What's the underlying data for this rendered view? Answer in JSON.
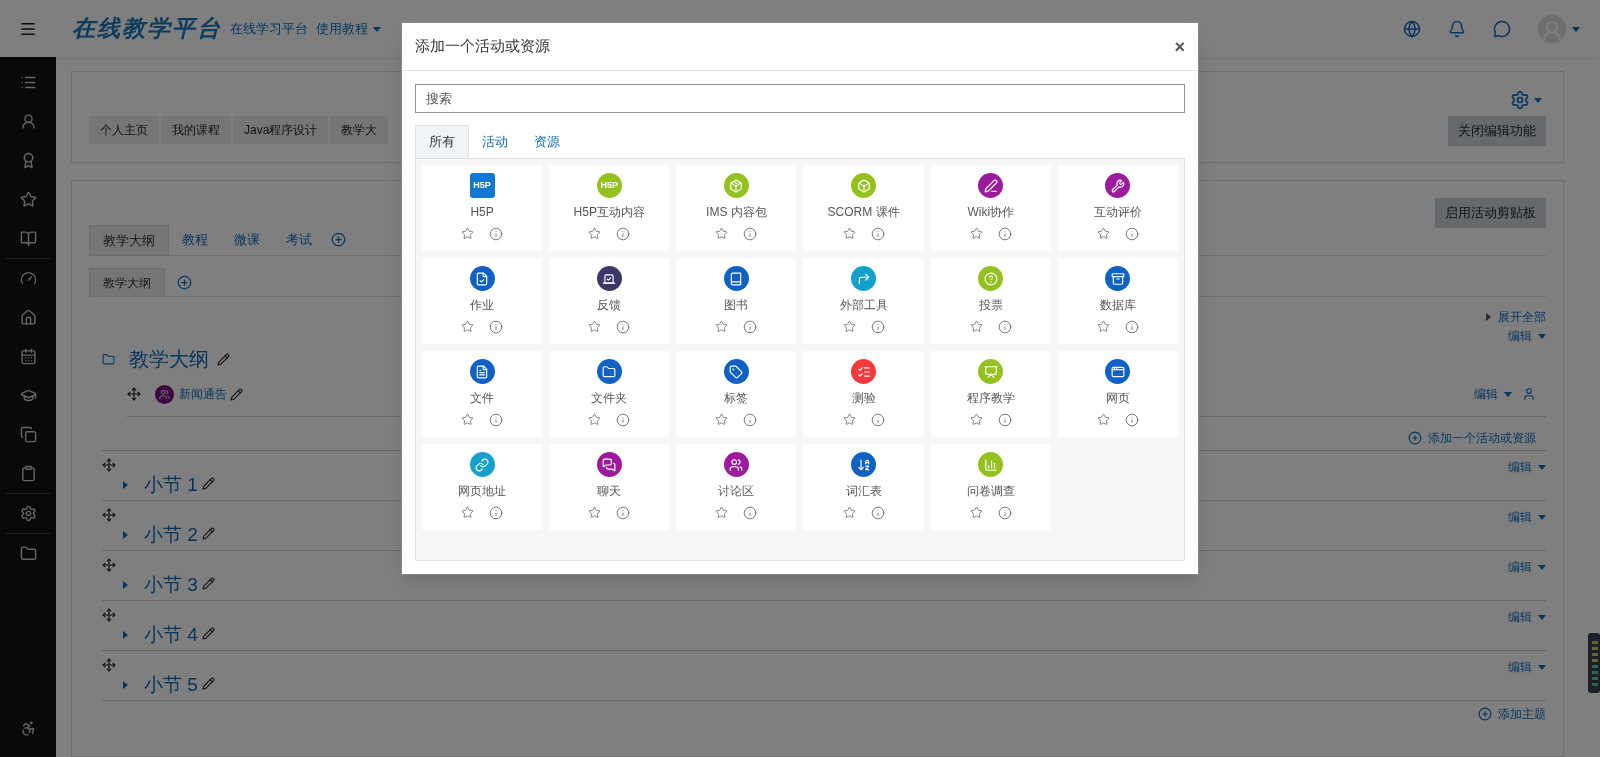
{
  "navbar": {
    "logo": "在线教学平台",
    "links": [
      {
        "label": "在线学习平台",
        "menu": false
      },
      {
        "label": "使用教程",
        "menu": true
      }
    ]
  },
  "header_card": {
    "breadcrumb": [
      "个人主页",
      "我的课程",
      "Java程序设计",
      "教学大"
    ],
    "button": "关闭编辑功能"
  },
  "course": {
    "clipboard_button": "启用活动剪贴板",
    "tabs": [
      {
        "label": "教学大纲",
        "selected": true
      },
      {
        "label": "教程",
        "selected": false
      },
      {
        "label": "微课",
        "selected": false
      },
      {
        "label": "考试",
        "selected": false
      }
    ],
    "subtabs": [
      {
        "label": "教学大纲",
        "selected": true
      }
    ],
    "expand_all": "展开全部",
    "main_section": {
      "title": "教学大纲",
      "edit": "编辑",
      "activities": [
        {
          "name": "新闻通告",
          "edit": "编辑"
        }
      ],
      "add_activity": "添加一个活动或资源"
    },
    "sections": [
      {
        "title": "小节 1",
        "edit": "编辑"
      },
      {
        "title": "小节 2",
        "edit": "编辑"
      },
      {
        "title": "小节 3",
        "edit": "编辑"
      },
      {
        "title": "小节 4",
        "edit": "编辑"
      },
      {
        "title": "小节 5",
        "edit": "编辑"
      }
    ],
    "add_topic": "添加主题"
  },
  "modal": {
    "title": "添加一个活动或资源",
    "close": "×",
    "search": {
      "placeholder": "搜索"
    },
    "tabs": [
      {
        "label": "所有",
        "selected": true
      },
      {
        "label": "活动",
        "selected": false
      },
      {
        "label": "资源",
        "selected": false
      }
    ],
    "items": [
      {
        "name": "H5P",
        "color": "#1177d1",
        "kind": "square",
        "logo": "H5P"
      },
      {
        "name": "H5P互动内容",
        "color": "#94c11f",
        "kind": "circle",
        "logo": "H5P"
      },
      {
        "name": "IMS 内容包",
        "color": "#94c11f",
        "kind": "circle"
      },
      {
        "name": "SCORM 课件",
        "color": "#94c11f",
        "kind": "circle"
      },
      {
        "name": "Wiki协作",
        "color": "#9c1a9c",
        "kind": "circle"
      },
      {
        "name": "互动评价",
        "color": "#9c1a9c",
        "kind": "circle"
      },
      {
        "name": "作业",
        "color": "#0f62c4",
        "kind": "circle"
      },
      {
        "name": "反馈",
        "color": "#3b3766",
        "kind": "circle"
      },
      {
        "name": "图书",
        "color": "#0f62c4",
        "kind": "circle"
      },
      {
        "name": "外部工具",
        "color": "#13a0cd",
        "kind": "circle"
      },
      {
        "name": "投票",
        "color": "#94c11f",
        "kind": "circle"
      },
      {
        "name": "数据库",
        "color": "#0f62c4",
        "kind": "circle"
      },
      {
        "name": "文件",
        "color": "#0f62c4",
        "kind": "circle"
      },
      {
        "name": "文件夹",
        "color": "#0f62c4",
        "kind": "circle"
      },
      {
        "name": "标签",
        "color": "#0f62c4",
        "kind": "circle"
      },
      {
        "name": "测验",
        "color": "#f5393c",
        "kind": "circle"
      },
      {
        "name": "程序教学",
        "color": "#94c11f",
        "kind": "circle"
      },
      {
        "name": "网页",
        "color": "#0f62c4",
        "kind": "circle"
      },
      {
        "name": "网页地址",
        "color": "#13a0cd",
        "kind": "circle"
      },
      {
        "name": "聊天",
        "color": "#9c1a9c",
        "kind": "circle"
      },
      {
        "name": "讨论区",
        "color": "#9c1a9c",
        "kind": "circle"
      },
      {
        "name": "词汇表",
        "color": "#0f62c4",
        "kind": "circle"
      },
      {
        "name": "问卷调查",
        "color": "#94c11f",
        "kind": "circle"
      }
    ]
  }
}
